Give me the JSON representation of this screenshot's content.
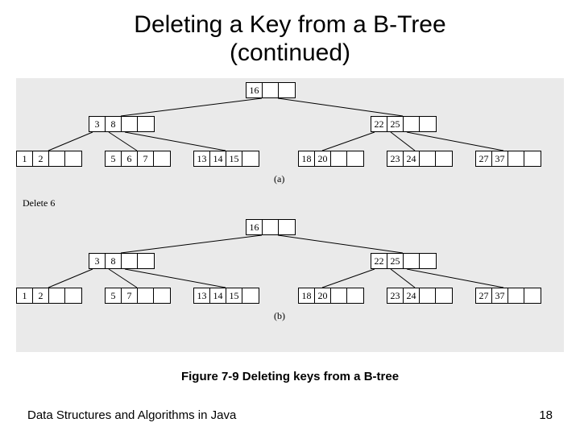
{
  "title_line1": "Deleting a Key from a B-Tree",
  "title_line2": "(continued)",
  "caption": "Figure 7-9 Deleting keys from a B-tree",
  "footer_text": "Data Structures and Algorithms in Java",
  "page_number": "18",
  "delete_label": "Delete 6",
  "subfig_a": "(a)",
  "subfig_b": "(b)",
  "tree_a": {
    "root": [
      "16",
      "",
      ""
    ],
    "mid_left": [
      "3",
      "8",
      "",
      ""
    ],
    "mid_right": [
      "22",
      "25",
      "",
      ""
    ],
    "leaf1": [
      "1",
      "2",
      "",
      ""
    ],
    "leaf2": [
      "5",
      "6",
      "7",
      ""
    ],
    "leaf3": [
      "13",
      "14",
      "15",
      ""
    ],
    "leaf4": [
      "18",
      "20",
      "",
      ""
    ],
    "leaf5": [
      "23",
      "24",
      "",
      ""
    ],
    "leaf6": [
      "27",
      "37",
      "",
      ""
    ]
  },
  "tree_b": {
    "root": [
      "16",
      "",
      ""
    ],
    "mid_left": [
      "3",
      "8",
      "",
      ""
    ],
    "mid_right": [
      "22",
      "25",
      "",
      ""
    ],
    "leaf1": [
      "1",
      "2",
      "",
      ""
    ],
    "leaf2": [
      "5",
      "7",
      "",
      ""
    ],
    "leaf3": [
      "13",
      "14",
      "15",
      ""
    ],
    "leaf4": [
      "18",
      "20",
      "",
      ""
    ],
    "leaf5": [
      "23",
      "24",
      "",
      ""
    ],
    "leaf6": [
      "27",
      "37",
      "",
      ""
    ]
  }
}
